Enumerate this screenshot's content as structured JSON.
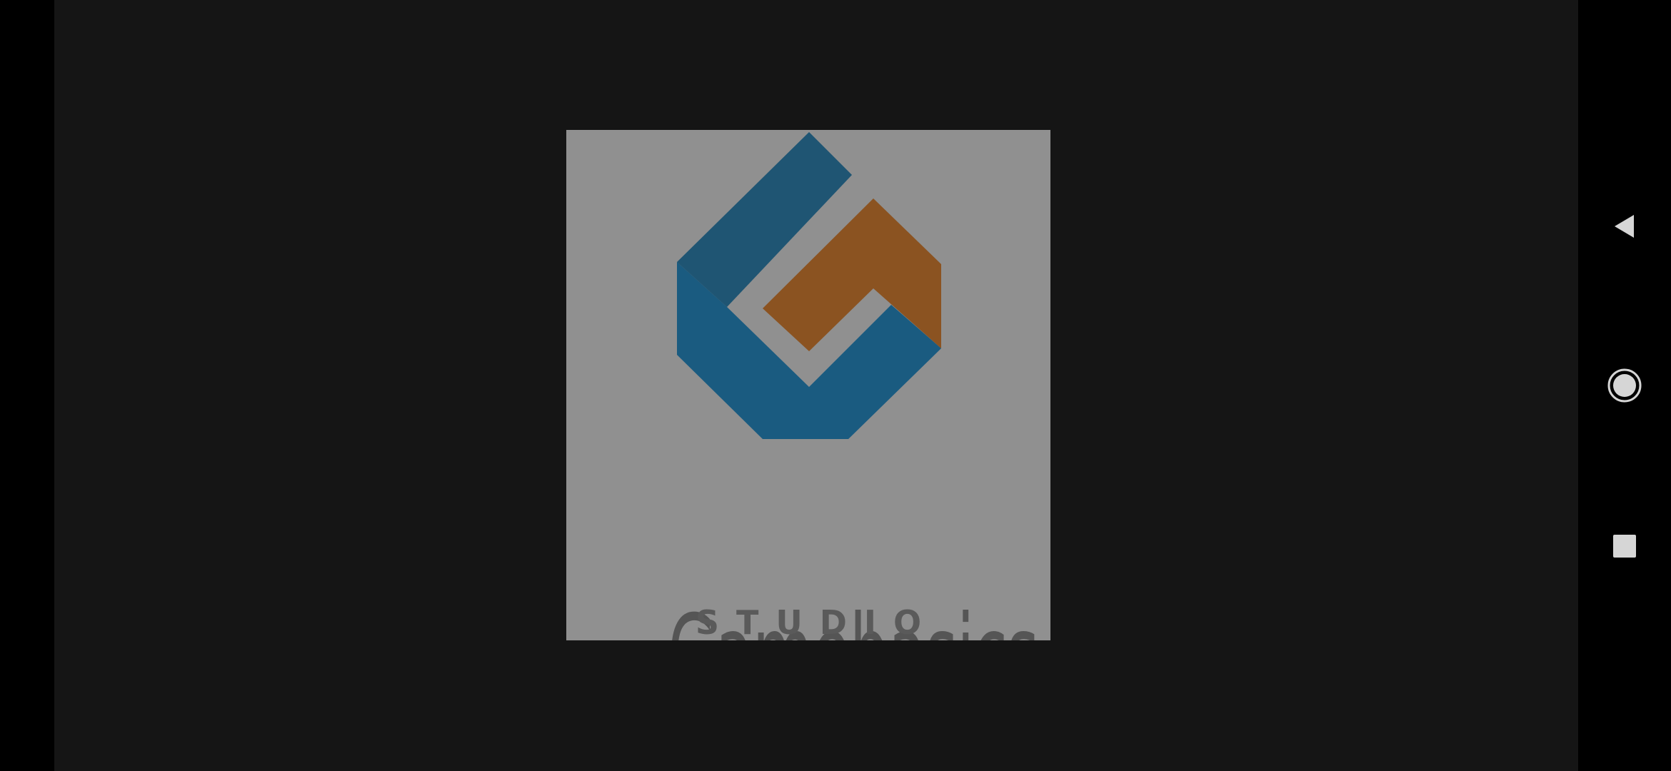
{
  "splash": {
    "brand_name": "Gamebasics",
    "tagline": "STUDIO"
  },
  "logo_colors": {
    "blue_dark": "#1f5573",
    "blue": "#1a5b80",
    "orange": "#8b5321",
    "card_bg": "#909090",
    "text": "#555555"
  },
  "navigation": {
    "back_icon": "back-triangle-icon",
    "home_icon": "home-circle-icon",
    "recents_icon": "recents-square-icon"
  }
}
